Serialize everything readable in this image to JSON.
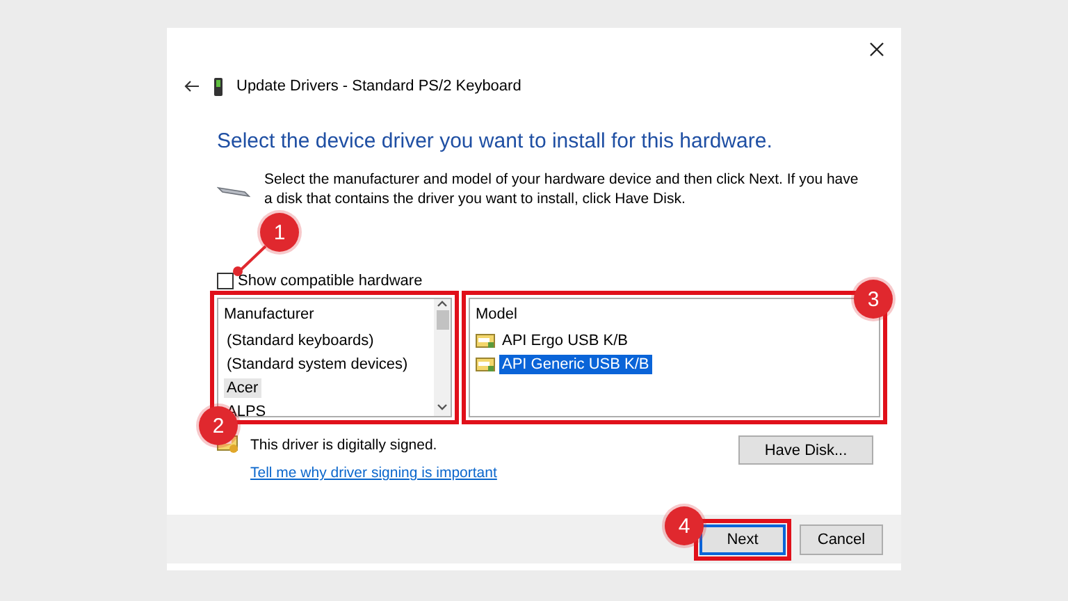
{
  "window": {
    "title": "Update Drivers - Standard PS/2 Keyboard"
  },
  "heading": "Select the device driver you want to install for this hardware.",
  "instructions": "Select the manufacturer and model of your hardware device and then click Next. If you have a disk that contains the driver you want to install, click Have Disk.",
  "compatible_checkbox": {
    "label": "Show compatible hardware",
    "checked": false,
    "callout": "1"
  },
  "manufacturer_list": {
    "header": "Manufacturer",
    "callout": "2",
    "items": [
      {
        "label": "(Standard keyboards)",
        "selected": false
      },
      {
        "label": "(Standard system devices)",
        "selected": false
      },
      {
        "label": "Acer",
        "selected": true
      },
      {
        "label": "ALPS",
        "selected": false
      }
    ]
  },
  "model_list": {
    "header": "Model",
    "callout": "3",
    "items": [
      {
        "label": "API Ergo USB K/B",
        "selected": false
      },
      {
        "label": "API Generic USB K/B",
        "selected": true
      }
    ]
  },
  "signature": {
    "text": "This driver is digitally signed.",
    "link": "Tell me why driver signing is important"
  },
  "have_disk_button": "Have Disk...",
  "buttons": [
    {
      "label": "Next",
      "default": true,
      "callout": "4"
    },
    {
      "label": "Cancel",
      "default": false
    }
  ]
}
